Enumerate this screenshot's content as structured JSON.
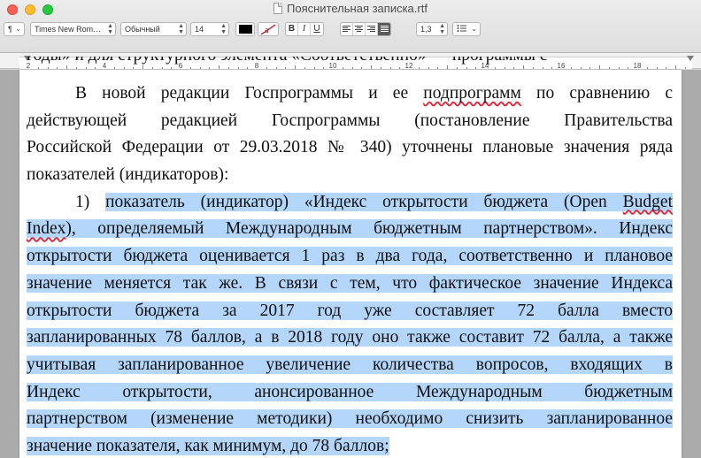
{
  "window": {
    "title": "Пояснительная записка.rtf"
  },
  "toolbar": {
    "paragraph_icon": "¶",
    "font_family": "Times New Rom…",
    "font_style": "Обычный",
    "font_size": "14",
    "text_color": "#000000",
    "bold": "B",
    "italic": "I",
    "underline": "U",
    "line_spacing": "1,3",
    "list_icon": "list-icon"
  },
  "ruler": {
    "labels": [
      "2",
      "4",
      "6",
      "8",
      "10",
      "12",
      "14",
      "16",
      "18"
    ]
  },
  "document": {
    "top_fragment": "годы» и для структурного элемента «Соответственно» — программы с",
    "paragraph1": [
      "В новой редакции Госпрограммы и ее подпрограмм по сравнению с",
      "действующей редакцией Госпрограммы (постановление Правительства",
      "Российской Федерации от 29.03.2018 № 340) уточнены плановые значения ряда",
      "показателей (индикаторов):"
    ],
    "paragraph2": {
      "number": "1)",
      "lines": [
        "показатель (индикатор) «Индекс открытости бюджета (Open Budget",
        "Index), определяемый Международным бюджетным партнерством». Индекс",
        "открытости бюджета оценивается 1 раз в два года, соответственно и плановое",
        "значение меняется так же. В связи с тем, что фактическое значение Индекса",
        "открытости бюджета за 2017 год уже составляет 72 балла вместо",
        "запланированных 78 баллов, а в 2018 году оно также составит 72 балла, а также",
        "учитывая запланированное увеличение количества вопросов, входящих в",
        "Индекс открытости, анонсированное Международным бюджетным",
        "партнерством (изменение методики) необходимо снизить запланированное",
        "значение показателя, как минимум, до 78 баллов;"
      ]
    }
  },
  "colors": {
    "selection": "#b4d6fb",
    "spellcheck": "#e0263c"
  }
}
